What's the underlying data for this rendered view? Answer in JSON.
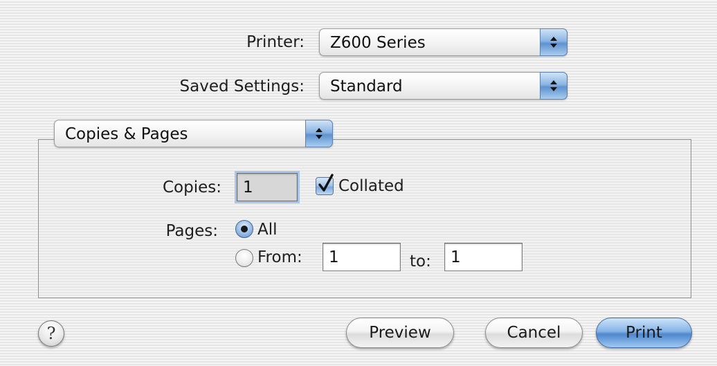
{
  "printer": {
    "label": "Printer:",
    "value": "Z600 Series"
  },
  "saved_settings": {
    "label": "Saved Settings:",
    "value": "Standard"
  },
  "panel": {
    "value": "Copies & Pages"
  },
  "copies": {
    "label": "Copies:",
    "value": "1",
    "collated_label": "Collated",
    "collated_checked": true
  },
  "pages": {
    "label": "Pages:",
    "all_label": "All",
    "all_selected": true,
    "from_label": "From:",
    "from_value": "1",
    "to_label": "to:",
    "to_value": "1"
  },
  "buttons": {
    "help_glyph": "?",
    "preview": "Preview",
    "cancel": "Cancel",
    "print": "Print"
  },
  "colors": {
    "accent": "#5f92d0",
    "default_button": "#4e87cf"
  },
  "icons": {
    "popup": "updown-arrows-icon",
    "check": "checkmark-icon",
    "help": "help-icon"
  }
}
